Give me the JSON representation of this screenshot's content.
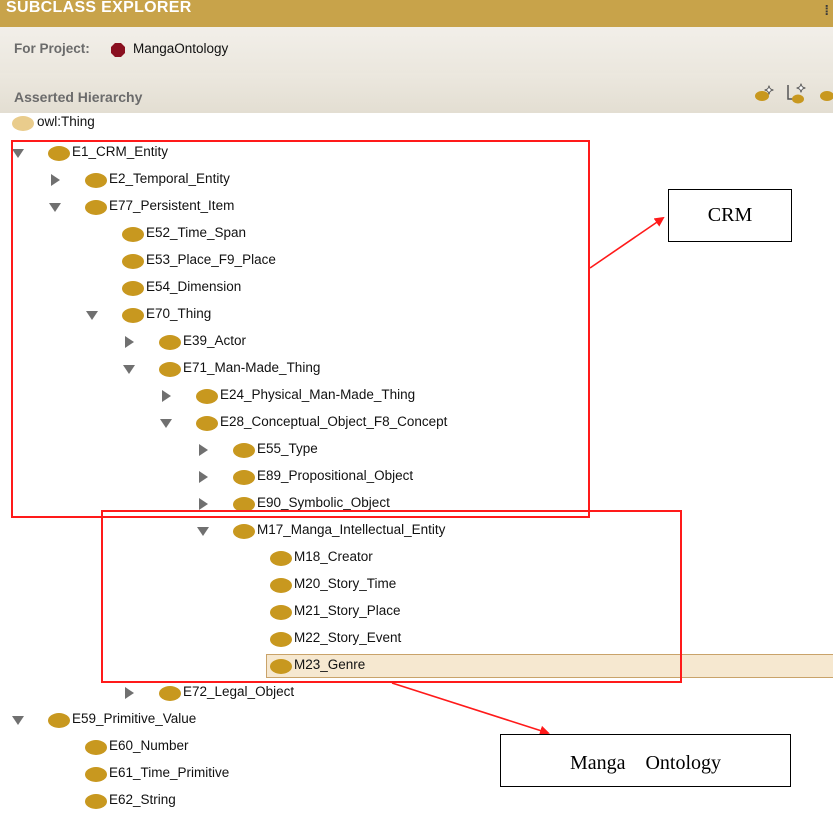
{
  "panel": {
    "title": "SUBCLASS EXPLORER",
    "project_label": "For Project:",
    "project_name": "MangaOntology",
    "hierarchy_label": "Asserted Hierarchy",
    "toolbar": [
      {
        "name": "create-subclass-button",
        "icon": "create-subclass-icon"
      },
      {
        "name": "create-sibling-class-button",
        "icon": "create-sibling-class-icon"
      },
      {
        "name": "delete-class-button",
        "icon": "delete-class-icon"
      }
    ]
  },
  "tree": {
    "selected": "M23_Genre",
    "nodes": [
      {
        "label": "owl:Thing",
        "depth": 0,
        "toggle": "none",
        "root": true
      },
      {
        "label": "E1_CRM_Entity",
        "depth": 0,
        "toggle": "expanded"
      },
      {
        "label": "E2_Temporal_Entity",
        "depth": 1,
        "toggle": "collapsed"
      },
      {
        "label": "E77_Persistent_Item",
        "depth": 1,
        "toggle": "expanded"
      },
      {
        "label": "E52_Time_Span",
        "depth": 2,
        "toggle": "none"
      },
      {
        "label": "E53_Place_F9_Place",
        "depth": 2,
        "toggle": "none"
      },
      {
        "label": "E54_Dimension",
        "depth": 2,
        "toggle": "none"
      },
      {
        "label": "E70_Thing",
        "depth": 2,
        "toggle": "expanded"
      },
      {
        "label": "E39_Actor",
        "depth": 3,
        "toggle": "collapsed"
      },
      {
        "label": "E71_Man-Made_Thing",
        "depth": 3,
        "toggle": "expanded"
      },
      {
        "label": "E24_Physical_Man-Made_Thing",
        "depth": 4,
        "toggle": "collapsed"
      },
      {
        "label": "E28_Conceptual_Object_F8_Concept",
        "depth": 4,
        "toggle": "expanded"
      },
      {
        "label": "E55_Type",
        "depth": 5,
        "toggle": "collapsed"
      },
      {
        "label": "E89_Propositional_Object",
        "depth": 5,
        "toggle": "collapsed"
      },
      {
        "label": "E90_Symbolic_Object",
        "depth": 5,
        "toggle": "collapsed"
      },
      {
        "label": "M17_Manga_Intellectual_Entity",
        "depth": 5,
        "toggle": "expanded"
      },
      {
        "label": "M18_Creator",
        "depth": 6,
        "toggle": "none"
      },
      {
        "label": "M20_Story_Time",
        "depth": 6,
        "toggle": "none"
      },
      {
        "label": "M21_Story_Place",
        "depth": 6,
        "toggle": "none"
      },
      {
        "label": "M22_Story_Event",
        "depth": 6,
        "toggle": "none"
      },
      {
        "label": "M23_Genre",
        "depth": 6,
        "toggle": "none"
      },
      {
        "label": "E72_Legal_Object",
        "depth": 3,
        "toggle": "collapsed"
      },
      {
        "label": "E59_Primitive_Value",
        "depth": 0,
        "toggle": "expanded"
      },
      {
        "label": "E60_Number",
        "depth": 1,
        "toggle": "none"
      },
      {
        "label": "E61_Time_Primitive",
        "depth": 1,
        "toggle": "none"
      },
      {
        "label": "E62_String",
        "depth": 1,
        "toggle": "none"
      }
    ]
  },
  "annotations": {
    "crm_label": "CRM",
    "manga_label": "Manga　Ontology",
    "highlight_color": "#ff1a1a"
  },
  "colors": {
    "header_bar": "#c8a34a",
    "class_icon": "#c8981f",
    "root_icon": "#e9cc8c",
    "project_icon": "#8a1020",
    "selection": "#f6e8d0"
  }
}
